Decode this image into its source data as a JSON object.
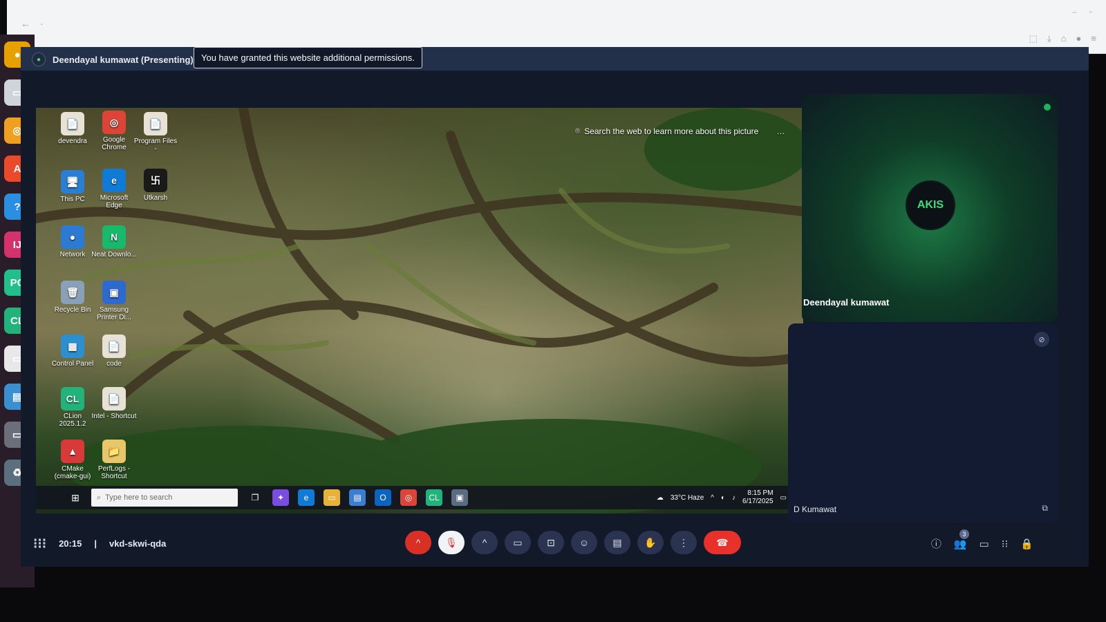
{
  "browser": {
    "permission_tooltip": "You have granted this website additional permissions."
  },
  "meet": {
    "presenter_label": "Deendayal kumawat (Presenting)",
    "time": "20:15",
    "separator": "|",
    "meeting_code": "vkd-skwi-qda",
    "participant_count_badge": "3",
    "tiles": {
      "top_name": "Deendayal kumawat",
      "avatar_text": "AKIS",
      "bottom_name": "D Kumawat"
    },
    "colors": {
      "accent_green": "#1fb45c",
      "end_call_red": "#e8312a",
      "panel_bg": "#121a2a"
    }
  },
  "shared_screen": {
    "search_hint": "Search the web to learn more about this picture",
    "search_hint_more": "…",
    "desktop_icons": [
      {
        "label": "devendra",
        "glyph": "📄",
        "color": "#e8e2d6"
      },
      {
        "label": "Google Chrome",
        "glyph": "◎",
        "color": "#db4437"
      },
      {
        "label": "Program Files -",
        "glyph": "📄",
        "color": "#e8e2d6"
      },
      {
        "label": "This PC",
        "glyph": "🖥",
        "color": "#2a7fd4"
      },
      {
        "label": "Microsoft Edge",
        "glyph": "e",
        "color": "#0f7bd6"
      },
      {
        "label": "Utkarsh",
        "glyph": "卐",
        "color": "#1a1a1a"
      },
      {
        "label": "Network",
        "glyph": "●",
        "color": "#2c7ad2"
      },
      {
        "label": "Neat Downlo...",
        "glyph": "N",
        "color": "#18b96a"
      },
      {
        "label": "Recycle Bin",
        "glyph": "🗑",
        "color": "#8aa0b8"
      },
      {
        "label": "Samsung Printer Di...",
        "glyph": "▣",
        "color": "#2d6ad0"
      },
      {
        "label": "Control Panel",
        "glyph": "▦",
        "color": "#2b8fd0"
      },
      {
        "label": "code",
        "glyph": "📄",
        "color": "#e8e2d6"
      },
      {
        "label": "CLion 2025.1.2",
        "glyph": "CL",
        "color": "#21b37a"
      },
      {
        "label": "Intel - Shortcut",
        "glyph": "📄",
        "color": "#e8e2d6"
      },
      {
        "label": "CMake (cmake-gui)",
        "glyph": "▲",
        "color": "#d83a3a"
      },
      {
        "label": "PerfLogs - Shortcut",
        "glyph": "📁",
        "color": "#e8c66a"
      }
    ],
    "taskbar": {
      "search_placeholder": "Type here to search",
      "weather": "33°C  Haze",
      "time": "8:15 PM",
      "date": "6/17/2025",
      "apps": [
        {
          "glyph": "❐",
          "color": "transparent"
        },
        {
          "glyph": "✦",
          "color": "#7a4de0"
        },
        {
          "glyph": "e",
          "color": "#0f7bd6"
        },
        {
          "glyph": "▭",
          "color": "#e8b23a"
        },
        {
          "glyph": "▤",
          "color": "#3b7ed0"
        },
        {
          "glyph": "O",
          "color": "#0b64c0"
        },
        {
          "glyph": "◎",
          "color": "#db4437"
        },
        {
          "glyph": "CL",
          "color": "#21b37a"
        },
        {
          "glyph": "▣",
          "color": "#5a6b82"
        }
      ]
    }
  },
  "dock": {
    "items": [
      {
        "glyph": "●",
        "color": "#e6a000"
      },
      {
        "glyph": "▭",
        "color": "#cfd3da"
      },
      {
        "glyph": "◎",
        "color": "#f0a020"
      },
      {
        "glyph": "A",
        "color": "#e84a2a"
      },
      {
        "glyph": "?",
        "color": "#2a8fe0"
      },
      {
        "glyph": "IJ",
        "color": "#d4326b"
      },
      {
        "glyph": "PC",
        "color": "#21c08a"
      },
      {
        "glyph": "CL",
        "color": "#21b37a"
      },
      {
        "glyph": "▭",
        "color": "#e8e8e8"
      },
      {
        "glyph": "▤",
        "color": "#3a8fd0"
      },
      {
        "glyph": "▭",
        "color": "#6b6f7a"
      },
      {
        "glyph": "♻",
        "color": "#5b6f7f"
      }
    ]
  }
}
